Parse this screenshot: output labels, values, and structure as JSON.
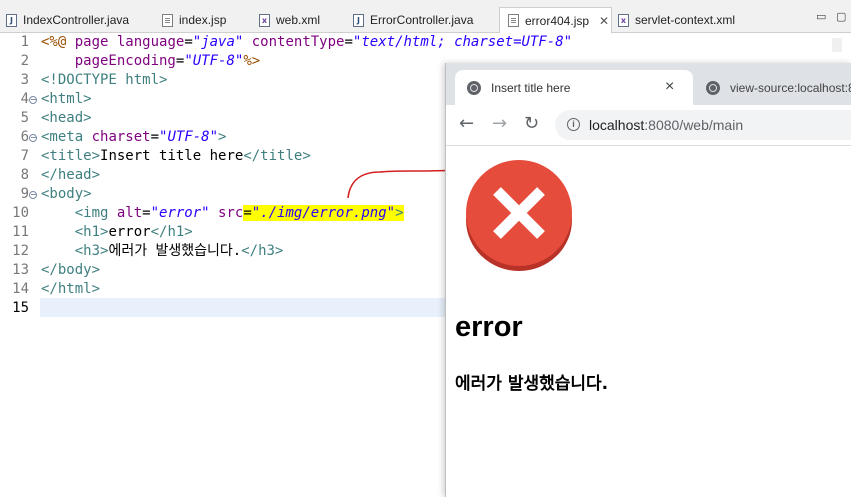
{
  "editor": {
    "tabs": [
      {
        "label": "IndexController.java",
        "icon": "java-file-icon"
      },
      {
        "label": "index.jsp",
        "icon": "jsp-file-icon"
      },
      {
        "label": "web.xml",
        "icon": "xml-file-icon"
      },
      {
        "label": "ErrorController.java",
        "icon": "java-file-icon"
      },
      {
        "label": "error404.jsp",
        "icon": "jsp-file-icon",
        "active": true
      },
      {
        "label": "servlet-context.xml",
        "icon": "xml-file-icon"
      }
    ],
    "line_numbers": [
      "1",
      "2",
      "3",
      "4",
      "5",
      "6",
      "7",
      "8",
      "9",
      "10",
      "11",
      "12",
      "13",
      "14",
      "15"
    ],
    "code": {
      "l1_open": "<%@",
      "l1_page": " page ",
      "l1_lang_attr": "language",
      "l1_eq1": "=",
      "l1_lang_val": "\"java\"",
      "l1_ct_attr": " contentType",
      "l1_eq2": "=",
      "l1_ct_val": "\"text/html; charset=UTF-8\"",
      "l2_indent": "    ",
      "l2_enc_attr": "pageEncoding",
      "l2_eq": "=",
      "l2_enc_val": "\"UTF-8\"",
      "l2_close": "%>",
      "l3": "<!DOCTYPE html>",
      "l4": "<html>",
      "l5": "<head>",
      "l6_tag": "<meta",
      "l6_attr": " charset",
      "l6_eq": "=",
      "l6_val": "\"UTF-8\"",
      "l6_close": ">",
      "l7_open": "<title>",
      "l7_text": "Insert title here",
      "l7_close": "</title>",
      "l8": "</head>",
      "l9": "<body>",
      "l10_indent": "    ",
      "l10_tag": "<img",
      "l10_alt_attr": " alt",
      "l10_eq1": "=",
      "l10_alt_val": "\"error\"",
      "l10_src_attr": " src",
      "l10_eq2": "=",
      "l10_src_val": "\"./img/error.png\"",
      "l10_close": ">",
      "l11_indent": "    ",
      "l11_open": "<h1>",
      "l11_text": "error",
      "l11_close": "</h1>",
      "l12_indent": "    ",
      "l12_open": "<h3>",
      "l12_text": "에러가 발생했습니다.",
      "l12_close": "</h3>",
      "l13": "</body>",
      "l14": "</html>"
    }
  },
  "browser": {
    "tab_active_title": "Insert title here",
    "tab_close": "×",
    "tab_inactive_title": "view-source:localhost:8",
    "url_host": "localhost",
    "url_rest": ":8080/web/main",
    "page": {
      "h1": "error",
      "h3": "에러가 발생했습니다."
    }
  },
  "colors": {
    "error_red": "#e64c3c",
    "error_shadow": "#b83227",
    "highlight": "#ffff00",
    "annotation": "#d42020"
  }
}
